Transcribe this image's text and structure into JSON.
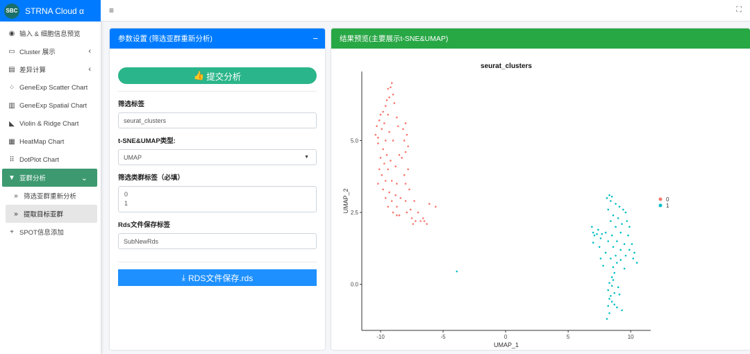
{
  "brand": {
    "logo": "SBC",
    "title": "STRNA Cloud α"
  },
  "sidebar": {
    "items": [
      {
        "label": "输入 & 细胞信息预览",
        "icon": "eye-icon"
      },
      {
        "label": "Cluster 展示",
        "icon": "desktop-icon",
        "chevron": "‹"
      },
      {
        "label": "差异计算",
        "icon": "calculator-icon",
        "chevron": "‹"
      },
      {
        "label": "GeneExp Scatter Chart",
        "icon": "spinner-icon"
      },
      {
        "label": "GeneExp Spatial Chart",
        "icon": "map-icon"
      },
      {
        "label": "Violin & Ridge Chart",
        "icon": "area-chart-icon"
      },
      {
        "label": "HeatMap Chart",
        "icon": "table-icon"
      },
      {
        "label": "DotPlot Chart",
        "icon": "grid-icon"
      },
      {
        "label": "亚群分析",
        "icon": "filter-icon",
        "chevron": "⌄",
        "active": true
      },
      {
        "label": "筛选亚群重新分析",
        "icon": "double-chevron-icon"
      },
      {
        "label": "提取目标亚群",
        "icon": "double-chevron-icon",
        "selected": true
      },
      {
        "label": "SPOT信息添加",
        "icon": "plus-icon"
      }
    ]
  },
  "topbar": {
    "menu_icon": "≡",
    "fullscreen_icon": "⛶"
  },
  "params": {
    "title": "参数设置 (筛选亚群重新分析)",
    "collapse": "−",
    "submit_label": "提交分析",
    "filter_label": "筛选标签",
    "filter_value": "seurat_clusters",
    "reduction_label": "t-SNE&UMAP类型:",
    "reduction_value": "UMAP",
    "clusters_label": "筛选类群标签（必填）",
    "clusters_values": [
      "0",
      "1"
    ],
    "rds_label": "Rds文件保存标签",
    "rds_value": "SubNewRds",
    "save_label": "RDS文件保存.rds"
  },
  "results": {
    "title": "结果预览(主要展示t-SNE&UMAP)"
  },
  "chart_data": {
    "type": "scatter",
    "title": "seurat_clusters",
    "xlabel": "UMAP_1",
    "ylabel": "UMAP_2",
    "xlim": [
      -11.5,
      11.6
    ],
    "ylim": [
      -1.6,
      7.4
    ],
    "xticks": [
      -10,
      -5,
      0,
      5,
      10
    ],
    "xtick_labels": [
      "-10",
      "-5",
      "0",
      "5",
      "10"
    ],
    "yticks": [
      0,
      2.5,
      5
    ],
    "ytick_labels": [
      "0.0",
      "2.5",
      "5.0"
    ],
    "grid": false,
    "legend": "right",
    "series": [
      {
        "name": "0",
        "color": "#f8766d",
        "points": [
          [
            -9.1,
            7.0
          ],
          [
            -9.2,
            6.85
          ],
          [
            -9.4,
            6.8
          ],
          [
            -9.0,
            6.6
          ],
          [
            -9.3,
            6.5
          ],
          [
            -9.5,
            6.4
          ],
          [
            -8.9,
            6.3
          ],
          [
            -9.6,
            6.2
          ],
          [
            -9.8,
            6.0
          ],
          [
            -10.0,
            5.9
          ],
          [
            -9.4,
            5.9
          ],
          [
            -8.7,
            5.8
          ],
          [
            -10.1,
            5.7
          ],
          [
            -9.7,
            5.6
          ],
          [
            -8.6,
            5.5
          ],
          [
            -10.3,
            5.5
          ],
          [
            -9.9,
            5.4
          ],
          [
            -9.3,
            5.3
          ],
          [
            -10.4,
            5.2
          ],
          [
            -10.2,
            5.1
          ],
          [
            -9.6,
            5.0
          ],
          [
            -9.0,
            5.0
          ],
          [
            -8.0,
            5.6
          ],
          [
            -8.2,
            5.4
          ],
          [
            -7.9,
            5.2
          ],
          [
            -8.1,
            5.0
          ],
          [
            -7.8,
            4.8
          ],
          [
            -8.0,
            4.6
          ],
          [
            -8.3,
            4.4
          ],
          [
            -10.2,
            4.9
          ],
          [
            -9.8,
            4.7
          ],
          [
            -9.5,
            4.5
          ],
          [
            -10.0,
            4.4
          ],
          [
            -9.2,
            4.3
          ],
          [
            -9.7,
            4.2
          ],
          [
            -10.1,
            4.0
          ],
          [
            -9.4,
            4.0
          ],
          [
            -8.8,
            4.1
          ],
          [
            -8.5,
            4.5
          ],
          [
            -7.8,
            4.0
          ],
          [
            -8.1,
            3.8
          ],
          [
            -9.9,
            3.8
          ],
          [
            -9.6,
            3.6
          ],
          [
            -9.1,
            3.6
          ],
          [
            -10.2,
            3.5
          ],
          [
            -8.7,
            3.5
          ],
          [
            -8.0,
            3.5
          ],
          [
            -7.7,
            3.3
          ],
          [
            -9.8,
            3.3
          ],
          [
            -9.3,
            3.2
          ],
          [
            -8.8,
            3.1
          ],
          [
            -8.4,
            3.0
          ],
          [
            -9.6,
            3.0
          ],
          [
            -9.1,
            2.9
          ],
          [
            -8.0,
            2.9
          ],
          [
            -9.4,
            2.7
          ],
          [
            -8.7,
            2.7
          ],
          [
            -7.6,
            2.6
          ],
          [
            -7.3,
            2.9
          ],
          [
            -9.0,
            2.5
          ],
          [
            -8.5,
            2.4
          ],
          [
            -7.9,
            2.5
          ],
          [
            -7.5,
            2.3
          ],
          [
            -7.0,
            2.5
          ],
          [
            -7.2,
            2.2
          ],
          [
            -6.6,
            2.3
          ],
          [
            -6.3,
            2.1
          ],
          [
            -6.5,
            2.2
          ],
          [
            -6.1,
            2.8
          ],
          [
            -5.6,
            2.7
          ],
          [
            -8.7,
            2.4
          ],
          [
            -7.4,
            2.1
          ],
          [
            -6.8,
            2.2
          ]
        ]
      },
      {
        "name": "1",
        "color": "#00bfc4",
        "points": [
          [
            -3.9,
            0.45
          ],
          [
            8.3,
            3.1
          ],
          [
            8.5,
            3.05
          ],
          [
            8.1,
            3.0
          ],
          [
            8.4,
            2.9
          ],
          [
            8.8,
            2.8
          ],
          [
            9.1,
            2.7
          ],
          [
            9.4,
            2.6
          ],
          [
            8.2,
            2.6
          ],
          [
            9.6,
            2.5
          ],
          [
            8.6,
            2.4
          ],
          [
            9.0,
            2.3
          ],
          [
            9.7,
            2.2
          ],
          [
            8.4,
            2.2
          ],
          [
            9.3,
            2.1
          ],
          [
            8.8,
            2.0
          ],
          [
            9.9,
            2.0
          ],
          [
            6.9,
            2.0
          ],
          [
            7.4,
            1.9
          ],
          [
            7.0,
            1.8
          ],
          [
            7.3,
            1.75
          ],
          [
            7.7,
            1.75
          ],
          [
            8.0,
            1.8
          ],
          [
            8.5,
            1.7
          ],
          [
            9.2,
            1.8
          ],
          [
            9.8,
            1.7
          ],
          [
            7.1,
            1.7
          ],
          [
            7.6,
            1.6
          ],
          [
            8.2,
            1.5
          ],
          [
            8.9,
            1.5
          ],
          [
            9.5,
            1.4
          ],
          [
            10.1,
            1.4
          ],
          [
            7.0,
            1.45
          ],
          [
            7.5,
            1.3
          ],
          [
            8.6,
            1.3
          ],
          [
            9.2,
            1.2
          ],
          [
            9.9,
            1.2
          ],
          [
            10.3,
            1.1
          ],
          [
            8.0,
            1.1
          ],
          [
            8.8,
            1.0
          ],
          [
            9.6,
            1.0
          ],
          [
            10.2,
            0.9
          ],
          [
            8.4,
            0.9
          ],
          [
            9.2,
            0.85
          ],
          [
            7.6,
            0.9
          ],
          [
            8.9,
            0.75
          ],
          [
            10.5,
            0.75
          ],
          [
            7.8,
            0.65
          ],
          [
            8.6,
            0.6
          ],
          [
            9.5,
            0.55
          ],
          [
            8.7,
            0.4
          ],
          [
            8.5,
            0.25
          ],
          [
            8.6,
            0.15
          ],
          [
            8.3,
            0.05
          ],
          [
            8.5,
            -0.05
          ],
          [
            9.0,
            -0.1
          ],
          [
            8.2,
            -0.2
          ],
          [
            8.7,
            -0.3
          ],
          [
            9.1,
            -0.35
          ],
          [
            8.4,
            -0.4
          ],
          [
            8.3,
            -0.5
          ],
          [
            8.5,
            -0.6
          ],
          [
            8.7,
            -0.7
          ],
          [
            8.2,
            -0.75
          ],
          [
            8.9,
            -0.8
          ],
          [
            9.3,
            -0.9
          ],
          [
            8.3,
            -1.0
          ],
          [
            8.1,
            -1.2
          ]
        ]
      }
    ]
  }
}
